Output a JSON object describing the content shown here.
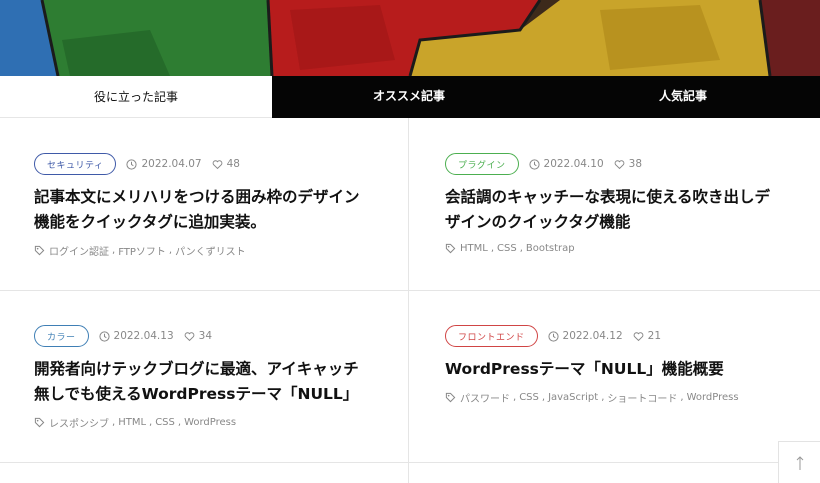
{
  "tabs": [
    {
      "label": "役に立った記事",
      "active": true
    },
    {
      "label": "オススメ記事",
      "active": false
    },
    {
      "label": "人気記事",
      "active": false
    }
  ],
  "posts": [
    {
      "category": "セキュリティ",
      "category_color": "#3f5aa8",
      "date": "2022.04.07",
      "likes": "48",
      "title_lines": [
        "記事本文にメリハリをつける囲み枠のデザイン",
        "機能をクイックタグに追加実装。"
      ],
      "tags": [
        "ログイン認証",
        "FTPソフト",
        "パンくずリスト"
      ]
    },
    {
      "category": "プラグイン",
      "category_color": "#4caf50",
      "date": "2022.04.10",
      "likes": "38",
      "title_lines": [
        "会話調のキャッチーな表現に使える吹き出しデ",
        "ザインのクイックタグ機能"
      ],
      "tags": [
        "HTML",
        "CSS",
        "Bootstrap"
      ]
    },
    {
      "category": "カラー",
      "category_color": "#3f7fb5",
      "date": "2022.04.13",
      "likes": "34",
      "title_lines": [
        "開発者向けテックブログに最適、アイキャッチ",
        "無しでも使えるWordPressテーマ「NULL」"
      ],
      "tags": [
        "レスポンシブ",
        "HTML",
        "CSS",
        "WordPress"
      ]
    },
    {
      "category": "フロントエンド",
      "category_color": "#d04545",
      "date": "2022.04.12",
      "likes": "21",
      "title_lines": [
        "WordPressテーマ「NULL」機能概要"
      ],
      "tags": [
        "パスワード",
        "CSS",
        "JavaScript",
        "ショートコード",
        "WordPress"
      ]
    }
  ],
  "icons": {
    "clock": "clock-icon",
    "heart": "heart-icon",
    "tag": "tag-icon",
    "scroll_top": "arrow-up-icon"
  }
}
